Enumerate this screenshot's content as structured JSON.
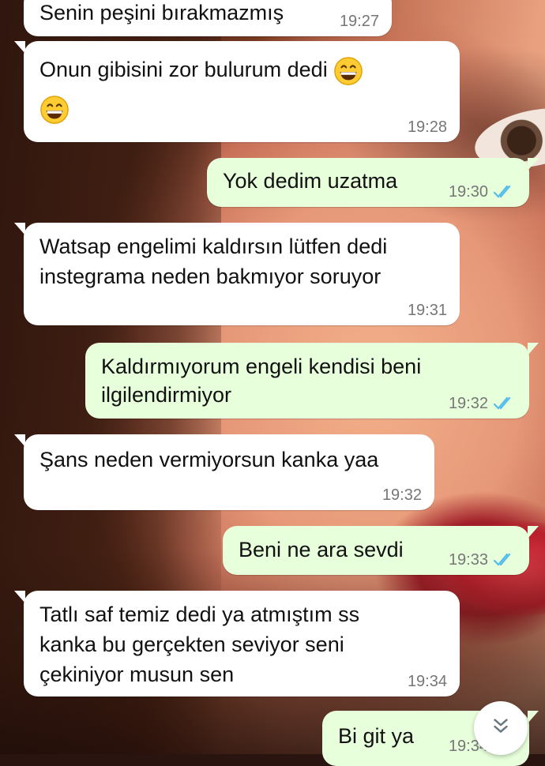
{
  "chat": {
    "messages": [
      {
        "dir": "in",
        "text": "Senin peşini bırakmazmış",
        "time": "19:27"
      },
      {
        "dir": "in",
        "lines": [
          "Onun gibisini zor bulurum dedi"
        ],
        "time": "19:28"
      },
      {
        "dir": "out",
        "text": "Yok dedim uzatma",
        "time": "19:30",
        "status": "read"
      },
      {
        "dir": "in",
        "lines": [
          "Watsap engelimi kaldırsın lütfen dedi",
          "instegrama neden bakmıyor soruyor"
        ],
        "time": "19:31"
      },
      {
        "dir": "out",
        "lines": [
          "Kaldırmıyorum engeli kendisi beni",
          "ilgilendirmiyor"
        ],
        "time": "19:32",
        "status": "read"
      },
      {
        "dir": "in",
        "text": "Şans neden vermiyorsun kanka yaa",
        "time": "19:32"
      },
      {
        "dir": "out",
        "text": "Beni ne ara sevdi",
        "time": "19:33",
        "status": "read"
      },
      {
        "dir": "in",
        "lines": [
          "Tatlı saf temiz dedi ya atmıştım ss",
          "kanka bu gerçekten seviyor seni",
          "çekiniyor musun sen"
        ],
        "time": "19:34"
      },
      {
        "dir": "out",
        "text": "Bi git ya",
        "time": "19:34",
        "status": "read"
      }
    ],
    "emoji_icon": "grinning-face-with-smiling-eyes",
    "read_tick_color": "#53bdeb",
    "incoming_bubble_color": "#ffffff",
    "outgoing_bubble_color": "#e7ffdb",
    "scroll_button_icon": "double-chevron-down-icon"
  }
}
